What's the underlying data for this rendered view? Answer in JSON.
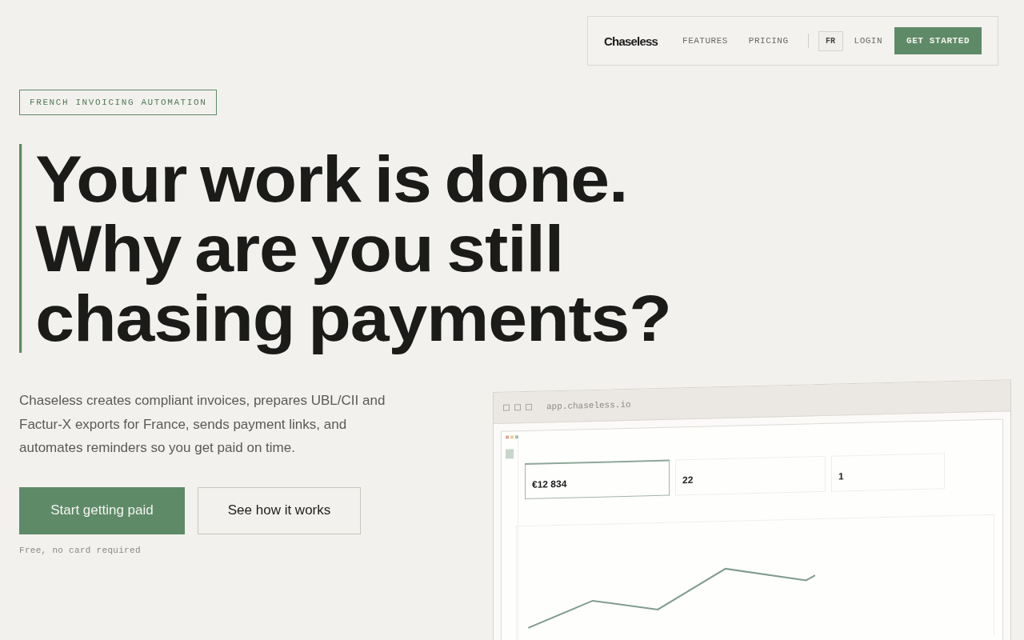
{
  "nav": {
    "brand": "Chaseless",
    "links": [
      "FEATURES",
      "PRICING"
    ],
    "language": "FR",
    "login": "LOGIN",
    "cta": "GET STARTED"
  },
  "hero": {
    "badge": "FRENCH INVOICING AUTOMATION",
    "headline_lines": [
      "Your work is done.",
      "Why are you still",
      "chasing payments?"
    ],
    "description": "Chaseless creates compliant invoices, prepares UBL/CII and Factur-X exports for France, sends payment links, and automates reminders so you get paid on time.",
    "primary_button": "Start getting paid",
    "secondary_button": "See how it works",
    "note": "Free, no card required"
  },
  "preview": {
    "url": "app.chaseless.io",
    "stats": [
      {
        "value": "€12 834",
        "selected": true
      },
      {
        "value": "22",
        "selected": false
      },
      {
        "value": "1",
        "selected": false
      }
    ]
  }
}
